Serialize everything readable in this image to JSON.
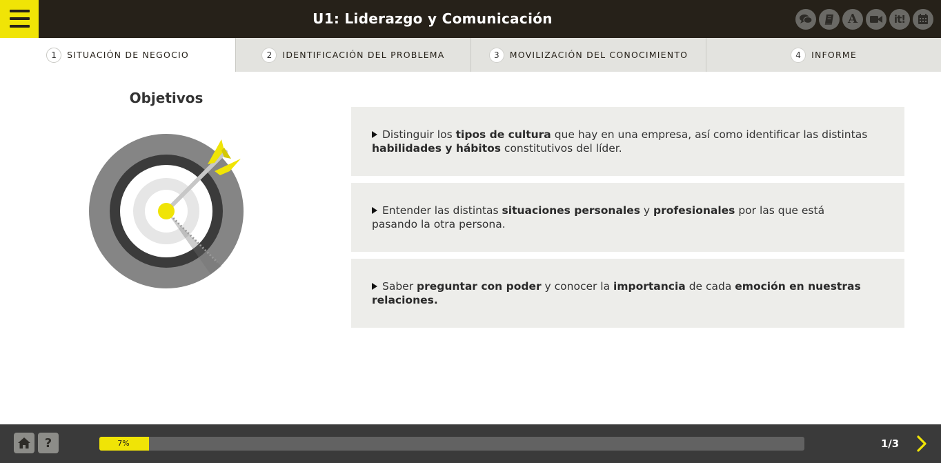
{
  "header": {
    "title": "U1: Liderazgo y Comunicación",
    "menu_icon": "hamburger-icon",
    "tools": [
      {
        "name": "chat-icon"
      },
      {
        "name": "book-icon"
      },
      {
        "name": "font-icon",
        "text": "A"
      },
      {
        "name": "video-camera-icon"
      },
      {
        "name": "it-icon",
        "text": "it!"
      },
      {
        "name": "calendar-icon"
      }
    ]
  },
  "tabs": [
    {
      "number": "1",
      "label": "SITUACIÓN DE NEGOCIO",
      "active": true
    },
    {
      "number": "2",
      "label": "IDENTIFICACIÓN DEL PROBLEMA",
      "active": false
    },
    {
      "number": "3",
      "label": "MOVILIZACIÓN DEL CONOCIMIENTO",
      "active": false
    },
    {
      "number": "4",
      "label": "INFORME",
      "active": false
    }
  ],
  "main": {
    "title": "Objetivos",
    "target_icon": "target-arrow-icon",
    "objectives": [
      [
        {
          "t": "Distinguir los ",
          "b": false
        },
        {
          "t": "tipos de cultura",
          "b": true
        },
        {
          "t": " que hay en una empresa, así como identificar las distintas ",
          "b": false
        },
        {
          "t": "habilidades y hábitos",
          "b": true
        },
        {
          "t": " constitutivos del líder.",
          "b": false
        }
      ],
      [
        {
          "t": "Entender las distintas ",
          "b": false
        },
        {
          "t": "situaciones personales",
          "b": true
        },
        {
          "t": " y ",
          "b": false
        },
        {
          "t": "profesionales",
          "b": true
        },
        {
          "t": " por las que está pasando la otra persona.",
          "b": false
        }
      ],
      [
        {
          "t": "Saber ",
          "b": false
        },
        {
          "t": "preguntar con poder",
          "b": true
        },
        {
          "t": " y conocer la ",
          "b": false
        },
        {
          "t": "importancia",
          "b": true
        },
        {
          "t": " de cada ",
          "b": false
        },
        {
          "t": "emoción en nuestras relaciones.",
          "b": true
        }
      ]
    ]
  },
  "footer": {
    "home_icon": "home-icon",
    "help_label": "?",
    "progress_label": "7%",
    "progress_value": 0.07,
    "page_indicator": "1/3",
    "next_icon": "chevron-right-icon"
  },
  "colors": {
    "accent": "#f0e406",
    "header_bg": "#262119",
    "footer_bg": "#3a3a3a",
    "card_bg": "#ededea",
    "tab_bg": "#e3e3df"
  }
}
